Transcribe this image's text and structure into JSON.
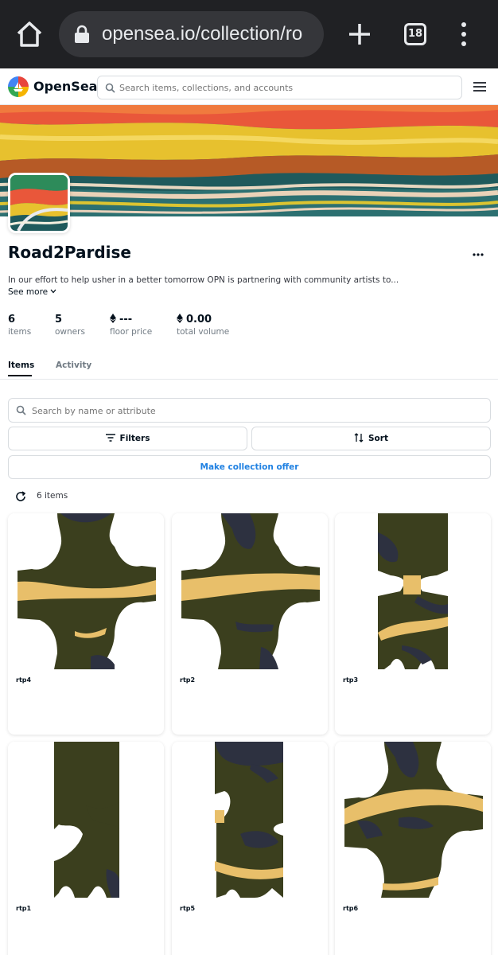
{
  "browser": {
    "url": "opensea.io/collection/ro",
    "tab_count": "18"
  },
  "header": {
    "brand": "OpenSea",
    "search_placeholder": "Search items, collections, and accounts"
  },
  "collection": {
    "title": "Road2Pardise",
    "description": "In our effort to help usher in a better tomorrow OPN is partnering with community artists to...",
    "see_more": "See more",
    "stats": [
      {
        "value": "6",
        "label": "items"
      },
      {
        "value": "5",
        "label": "owners"
      },
      {
        "value": "---",
        "label": "floor price"
      },
      {
        "value": "0.00",
        "label": "total volume"
      }
    ]
  },
  "tabs": {
    "items": "Items",
    "activity": "Activity"
  },
  "filters": {
    "search_placeholder": "Search by name or attribute",
    "filters_label": "Filters",
    "sort_label": "Sort",
    "offer_label": "Make collection offer",
    "count_label": "6 items"
  },
  "items": [
    {
      "name": "rtp4"
    },
    {
      "name": "rtp2"
    },
    {
      "name": "rtp3"
    },
    {
      "name": "rtp1"
    },
    {
      "name": "rtp5"
    },
    {
      "name": "rtp6"
    }
  ],
  "colors": {
    "olive": "#3b3f1e",
    "navy": "#2d3140",
    "sand": "#e8bf6a",
    "accent": "#2081e2"
  }
}
